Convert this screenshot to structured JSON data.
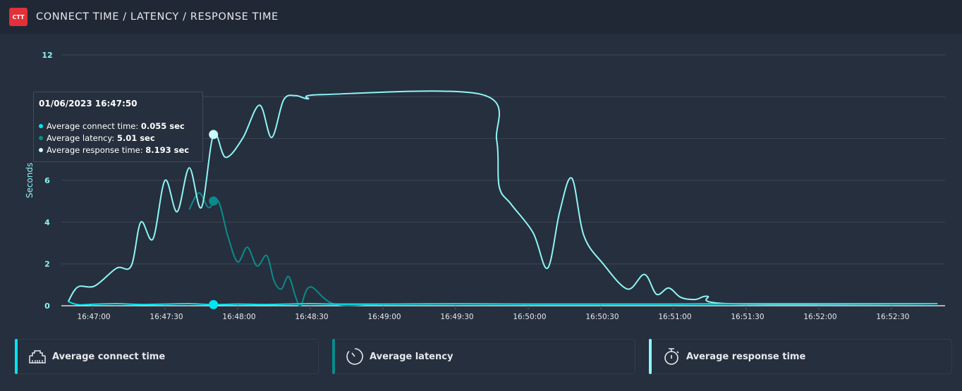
{
  "header": {
    "badge": "CTT",
    "title": "CONNECT TIME / LATENCY / RESPONSE TIME"
  },
  "colors": {
    "connect": "#00e5f0",
    "latency": "#0b8a8c",
    "response": "#8ef5f7",
    "grid": "#3d4654",
    "axis_label": "#8ef5f7",
    "tick_label": "#e6e8ec"
  },
  "tooltip": {
    "date": "01/06/2023 16:47:50",
    "rows": [
      {
        "label": "Average connect time: ",
        "value": "0.055 sec",
        "icon": "dot-connect"
      },
      {
        "label": "Average latency: ",
        "value": "5.01 sec",
        "icon": "dot-latency"
      },
      {
        "label": "Average response time: ",
        "value": "8.193 sec",
        "icon": "dot-response"
      }
    ]
  },
  "legend": [
    {
      "label": "Average connect time",
      "icon": "ethernet-port-icon"
    },
    {
      "label": "Average latency",
      "icon": "gauge-timer-icon"
    },
    {
      "label": "Average response time",
      "icon": "stopwatch-icon"
    }
  ],
  "chart_data": {
    "type": "line",
    "title": "CONNECT TIME / LATENCY / RESPONSE TIME",
    "xlabel": "",
    "ylabel": "Seconds",
    "ylim": [
      0,
      12
    ],
    "yticks": [
      0,
      2,
      4,
      6,
      8,
      10,
      12
    ],
    "ytick_labels_visible": [
      "0",
      "2",
      "4",
      "6",
      "",
      "",
      "12"
    ],
    "x_start": "16:46:50",
    "x_end": "16:52:50",
    "x_unit": "seconds since 16:46:50",
    "xticks": [
      10,
      40,
      70,
      100,
      130,
      160,
      190,
      220,
      250,
      280,
      310,
      340
    ],
    "xtick_labels": [
      "16:47:00",
      "16:47:30",
      "16:48:00",
      "16:48:30",
      "16:49:00",
      "16:49:30",
      "16:50:00",
      "16:50:30",
      "16:51:00",
      "16:51:30",
      "16:52:00",
      "16:52:30"
    ],
    "grid": true,
    "legend_position": "bottom",
    "highlight_x": 60,
    "series": [
      {
        "name": "Average connect time",
        "x": [
          0,
          4,
          10,
          20,
          30,
          40,
          50,
          60,
          70,
          80,
          90,
          100,
          110,
          130,
          160,
          190,
          220,
          250,
          280,
          310,
          340,
          359
        ],
        "values": [
          0.2,
          0.05,
          0.07,
          0.1,
          0.06,
          0.08,
          0.1,
          0.055,
          0.08,
          0.06,
          0.08,
          0.1,
          0.08,
          0.08,
          0.09,
          0.08,
          0.08,
          0.08,
          0.1,
          0.1,
          0.1,
          0.1
        ]
      },
      {
        "name": "Average latency",
        "x": [
          50,
          54,
          58,
          62,
          66,
          70,
          74,
          78,
          82,
          85,
          88,
          91,
          94,
          96,
          100,
          110,
          130,
          160,
          190,
          220,
          250,
          359
        ],
        "values": [
          4.6,
          5.4,
          4.7,
          5.01,
          3.3,
          2.1,
          2.8,
          1.9,
          2.4,
          1.2,
          0.8,
          1.4,
          0.4,
          0.0,
          0.9,
          0.08,
          0.08,
          0.1,
          0.08,
          0.08,
          0.08,
          0.1
        ]
      },
      {
        "name": "Average response time",
        "x": [
          0,
          4,
          11,
          20,
          26,
          30,
          35,
          40,
          45,
          50,
          55,
          60,
          65,
          72,
          79,
          84,
          89,
          94,
          99,
          105,
          171,
          177,
          178,
          183,
          192,
          198,
          203,
          208,
          213,
          221,
          231,
          238,
          243,
          248,
          253,
          259,
          264,
          273,
          359
        ],
        "values": [
          0.2,
          0.9,
          0.95,
          1.8,
          1.9,
          4.0,
          3.2,
          6.0,
          4.5,
          6.6,
          4.7,
          8.193,
          7.1,
          8.0,
          9.6,
          8.05,
          9.85,
          10.05,
          9.9,
          10.1,
          10.1,
          7.9,
          5.7,
          4.85,
          3.5,
          1.8,
          4.5,
          6.1,
          3.35,
          2.0,
          0.8,
          1.5,
          0.55,
          0.85,
          0.4,
          0.3,
          0.45,
          0.1,
          0.1
        ]
      }
    ]
  }
}
